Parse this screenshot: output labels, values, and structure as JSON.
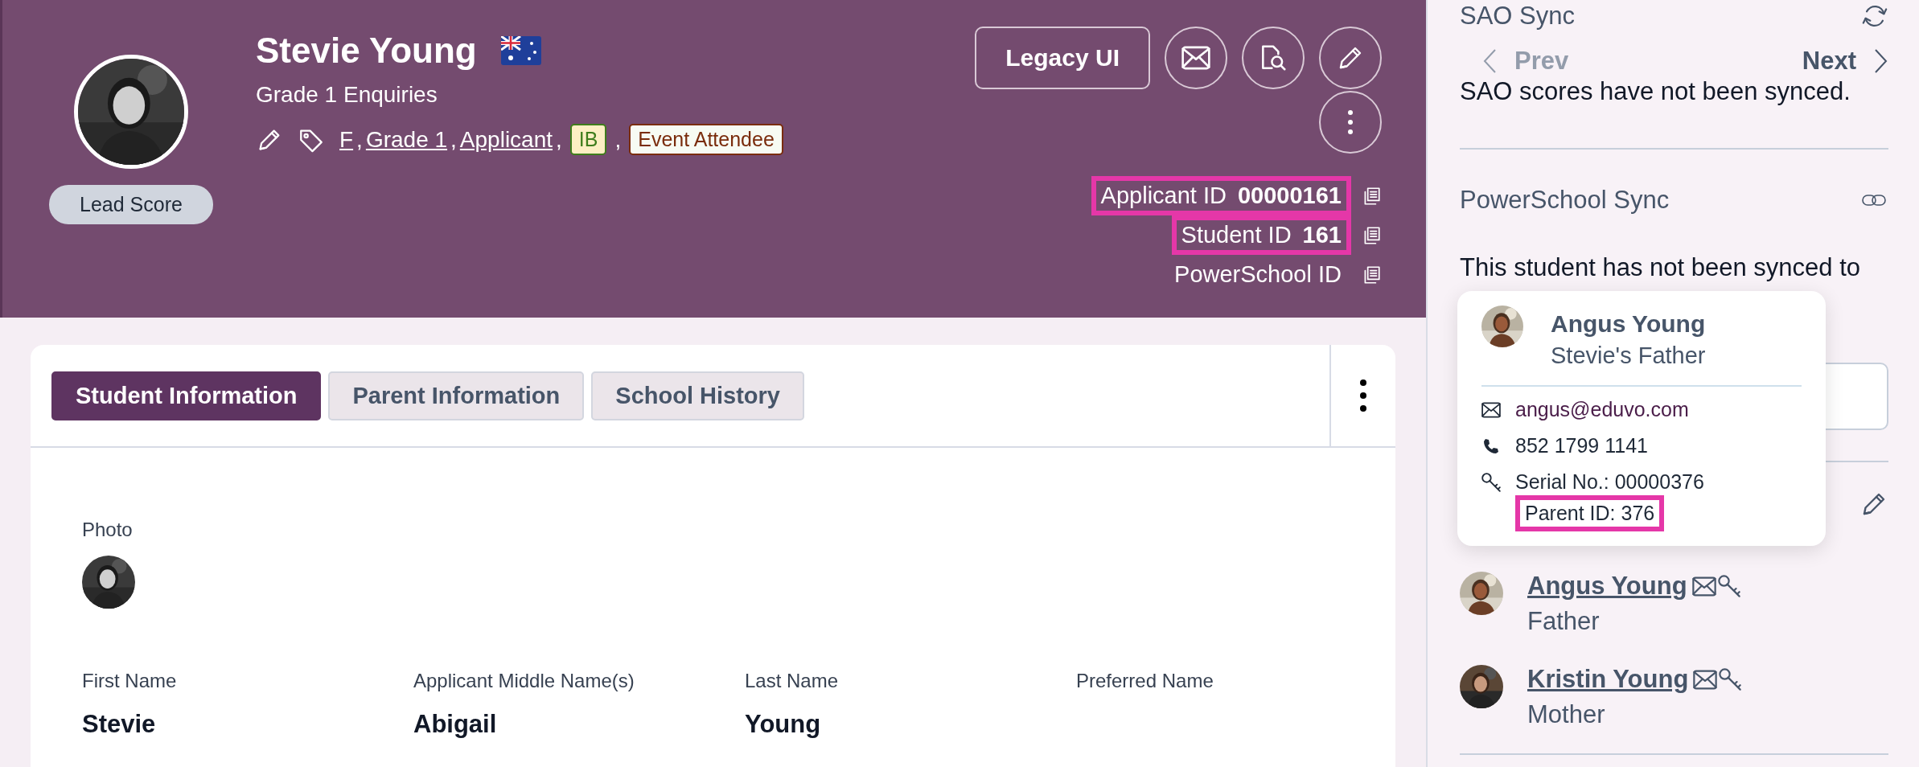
{
  "profile": {
    "name": "Stevie Young",
    "subtitle": "Grade 1 Enquiries",
    "lead_score": "Lead Score",
    "separator": ",",
    "tags": [
      {
        "text": "F",
        "kind": "link"
      },
      {
        "text": "Grade 1",
        "kind": "link"
      },
      {
        "text": "Applicant",
        "kind": "link"
      },
      {
        "text": "IB",
        "kind": "badge",
        "color": "#3f7d1c"
      },
      {
        "text": "Event Attendee",
        "kind": "badge",
        "color": "#7a2c0c"
      }
    ]
  },
  "actions": {
    "legacy_button": "Legacy UI"
  },
  "ids": [
    {
      "label": "Applicant ID",
      "value": "00000161",
      "highlighted": true
    },
    {
      "label": "Student ID",
      "value": "161",
      "highlighted": true
    },
    {
      "label": "PowerSchool ID",
      "highlighted": false
    }
  ],
  "tabs": [
    {
      "label": "Student Information",
      "selected": true
    },
    {
      "label": "Parent Information",
      "selected": false
    },
    {
      "label": "School History",
      "selected": false
    }
  ],
  "student_info": {
    "photo_label": "Photo",
    "fields": [
      {
        "label": "First Name",
        "value": "Stevie"
      },
      {
        "label": "Applicant Middle Name(s)",
        "value": "Abigail"
      },
      {
        "label": "Last Name",
        "value": "Young"
      },
      {
        "label": "Preferred Name"
      }
    ]
  },
  "sidebar": {
    "sao_title": "SAO Sync",
    "pager": [
      {
        "label": "Prev",
        "disabled": true
      },
      {
        "label": "Next",
        "disabled": false
      }
    ],
    "sao_message": "SAO scores have not been synced.",
    "powerschool_title": "PowerSchool Sync",
    "powerschool_message": "This student has not been synced to",
    "parents": [
      {
        "name": "Angus Young",
        "relation": "Father"
      },
      {
        "name": "Kristin Young",
        "relation": "Mother"
      }
    ]
  },
  "popup": {
    "name": "Angus Young",
    "relation": "Stevie's Father",
    "email": "angus@eduvo.com",
    "phone": "852 1799 1141",
    "serial": "Serial No.: 00000376",
    "parent_id": "Parent ID: 376",
    "parent_id_highlighted": true
  }
}
